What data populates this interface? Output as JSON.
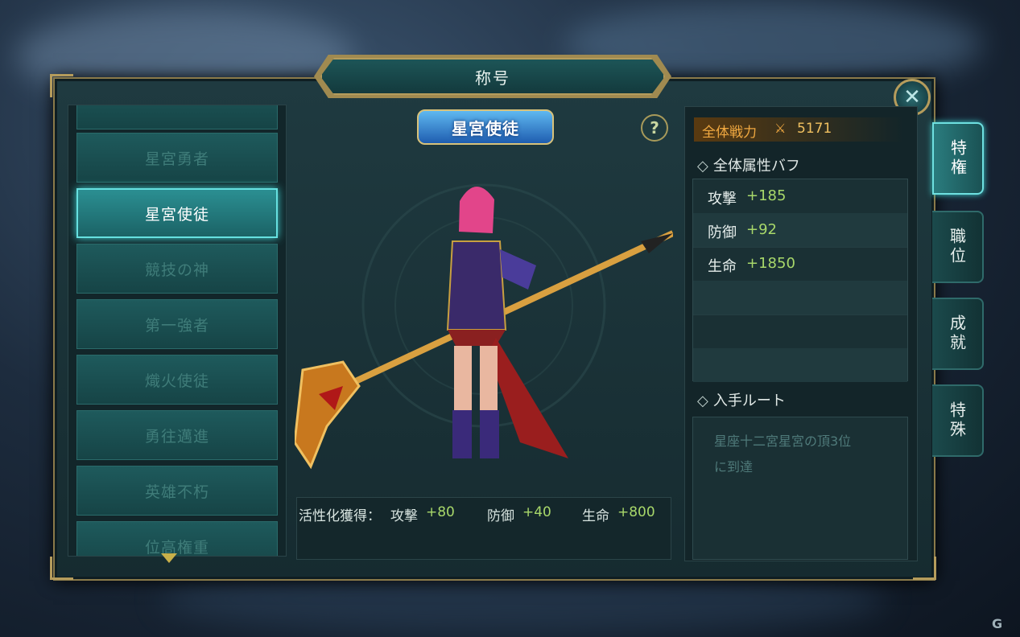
{
  "window": {
    "title": "称号"
  },
  "title_badge": "星宮使徒",
  "title_list": {
    "items": [
      {
        "label": ""
      },
      {
        "label": "星宮勇者"
      },
      {
        "label": "星宮使徒"
      },
      {
        "label": "競技の神"
      },
      {
        "label": "第一強者"
      },
      {
        "label": "熾火使徒"
      },
      {
        "label": "勇往邁進"
      },
      {
        "label": "英雄不朽"
      },
      {
        "label": "位高権重"
      }
    ],
    "selected_index": 2
  },
  "activation": {
    "prefix": "活性化獲得：",
    "stats": [
      {
        "label": "攻撃",
        "value": "+80"
      },
      {
        "label": "防御",
        "value": "+40"
      },
      {
        "label": "生命",
        "value": "+800"
      }
    ]
  },
  "power": {
    "label": "全体戦力",
    "value": "5171"
  },
  "buffs": {
    "header": "全体属性バフ",
    "rows": [
      {
        "label": "攻撃",
        "value": "+185"
      },
      {
        "label": "防御",
        "value": "+92"
      },
      {
        "label": "生命",
        "value": "+1850"
      }
    ]
  },
  "route": {
    "header": "入手ルート",
    "text_line1": "星座十二宮星宮の頂3位",
    "text_line2": "に到達"
  },
  "tabs": [
    {
      "label": "特権",
      "active": true
    },
    {
      "label": "職位",
      "active": false
    },
    {
      "label": "成就",
      "active": false
    },
    {
      "label": "特殊",
      "active": false
    }
  ],
  "icons": {
    "close": "close-icon",
    "help": "help-icon"
  },
  "colors": {
    "accent": "#66e0e0",
    "buff_value": "#a8d86a",
    "power": "#f0a840",
    "frame_gold": "#b59c5c"
  }
}
